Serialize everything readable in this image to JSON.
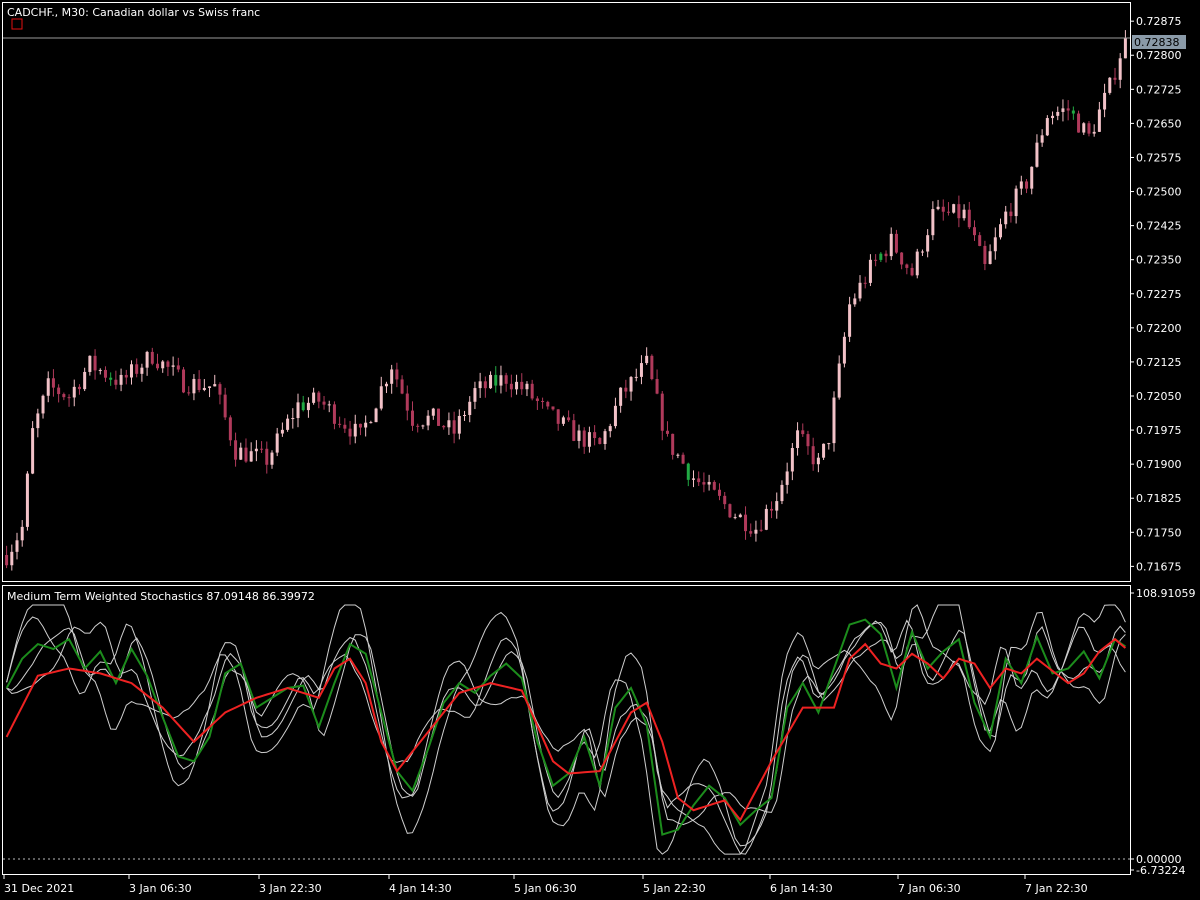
{
  "colors": {
    "background": "#000000",
    "frame": "#ffffff",
    "candle_up": "#f2c2c8",
    "candle_down": "#b03a5b",
    "candle_tick": "#22aa44",
    "bid_line": "#9a9a9a",
    "bid_tag": "#8a9aa8",
    "k_line": "#1c8c1c",
    "d_line": "#ee2222",
    "band_line": "#cfcfcf",
    "zero_line": "#bbbbbb"
  },
  "header": {
    "title": "CADCHF., M30:  Canadian dollar vs Swiss franc",
    "marker_icon": "red-square-icon"
  },
  "indicator": {
    "name": "Medium Term Weighted Stochastics",
    "value_k": "87.09148",
    "value_d": "86.39972"
  },
  "price_axis": {
    "ticks": [
      "0.72875",
      "0.72800",
      "0.72725",
      "0.72650",
      "0.72575",
      "0.72500",
      "0.72425",
      "0.72350",
      "0.72275",
      "0.72200",
      "0.72125",
      "0.72050",
      "0.71975",
      "0.71900",
      "0.71825",
      "0.71750",
      "0.71675"
    ],
    "current_price": "0.72838"
  },
  "indicator_axis": {
    "top_label": "108.91059",
    "zero_label": "0.00000",
    "bottom_label": "-6.73224"
  },
  "time_axis": {
    "labels": [
      "31 Dec 2021",
      "3 Jan 06:30",
      "3 Jan 22:30",
      "4 Jan 14:30",
      "5 Jan 06:30",
      "5 Jan 22:30",
      "6 Jan 14:30",
      "7 Jan 06:30",
      "7 Jan 22:30"
    ]
  },
  "chart_data": [
    {
      "type": "candlestick",
      "symbol": "CADCHF.",
      "timeframe": "M30",
      "description": "Canadian dollar vs Swiss franc",
      "ylim": [
        0.71645,
        0.72915
      ],
      "current_price": 0.72838,
      "bars": 216,
      "close_path": [
        [
          0,
          0.717
        ],
        [
          3,
          0.7176
        ],
        [
          5,
          0.7197
        ],
        [
          8,
          0.7207
        ],
        [
          12,
          0.7205
        ],
        [
          16,
          0.7212
        ],
        [
          22,
          0.7208
        ],
        [
          28,
          0.7214
        ],
        [
          34,
          0.7208
        ],
        [
          40,
          0.7207
        ],
        [
          44,
          0.7193
        ],
        [
          50,
          0.7191
        ],
        [
          56,
          0.7203
        ],
        [
          60,
          0.7204
        ],
        [
          64,
          0.72
        ],
        [
          68,
          0.7196
        ],
        [
          74,
          0.7212
        ],
        [
          78,
          0.72
        ],
        [
          82,
          0.72
        ],
        [
          86,
          0.7197
        ],
        [
          90,
          0.7206
        ],
        [
          96,
          0.7209
        ],
        [
          100,
          0.7206
        ],
        [
          104,
          0.7201
        ],
        [
          110,
          0.7196
        ],
        [
          114,
          0.7194
        ],
        [
          118,
          0.7205
        ],
        [
          123,
          0.7212
        ],
        [
          127,
          0.7195
        ],
        [
          132,
          0.7187
        ],
        [
          136,
          0.7183
        ],
        [
          140,
          0.7179
        ],
        [
          144,
          0.7176
        ],
        [
          148,
          0.7183
        ],
        [
          152,
          0.7196
        ],
        [
          156,
          0.719
        ],
        [
          158,
          0.7196
        ],
        [
          162,
          0.7225
        ],
        [
          166,
          0.7233
        ],
        [
          170,
          0.7239
        ],
        [
          174,
          0.7232
        ],
        [
          178,
          0.7245
        ],
        [
          184,
          0.7245
        ],
        [
          188,
          0.7233
        ],
        [
          192,
          0.7245
        ],
        [
          196,
          0.7252
        ],
        [
          200,
          0.7267
        ],
        [
          204,
          0.7268
        ],
        [
          208,
          0.7262
        ],
        [
          212,
          0.7273
        ],
        [
          215,
          0.7284
        ]
      ]
    },
    {
      "type": "line",
      "title": "Medium Term Weighted Stochastics",
      "ylim": [
        -6.73224,
        108.91059
      ],
      "last_values": [
        87.09148,
        86.39972
      ],
      "series": [
        {
          "color": "#1c8c1c",
          "points": [
            [
              0,
              70
            ],
            [
              3,
              82
            ],
            [
              6,
              88
            ],
            [
              9,
              86
            ],
            [
              12,
              90
            ],
            [
              15,
              78
            ],
            [
              18,
              85
            ],
            [
              21,
              72
            ],
            [
              24,
              86
            ],
            [
              27,
              75
            ],
            [
              30,
              58
            ],
            [
              33,
              42
            ],
            [
              36,
              40
            ],
            [
              39,
              50
            ],
            [
              42,
              76
            ],
            [
              45,
              80
            ],
            [
              48,
              62
            ],
            [
              51,
              66
            ],
            [
              54,
              70
            ],
            [
              57,
              71
            ],
            [
              60,
              54
            ],
            [
              63,
              72
            ],
            [
              66,
              88
            ],
            [
              69,
              84
            ],
            [
              72,
              60
            ],
            [
              75,
              36
            ],
            [
              78,
              28
            ],
            [
              81,
              45
            ],
            [
              84,
              64
            ],
            [
              87,
              72
            ],
            [
              90,
              68
            ],
            [
              93,
              75
            ],
            [
              96,
              80
            ],
            [
              99,
              74
            ],
            [
              102,
              48
            ],
            [
              105,
              30
            ],
            [
              108,
              35
            ],
            [
              111,
              50
            ],
            [
              114,
              30
            ],
            [
              117,
              62
            ],
            [
              120,
              70
            ],
            [
              123,
              55
            ],
            [
              126,
              10
            ],
            [
              129,
              12
            ],
            [
              132,
              22
            ],
            [
              135,
              30
            ],
            [
              138,
              25
            ],
            [
              141,
              14
            ],
            [
              144,
              20
            ],
            [
              147,
              25
            ],
            [
              150,
              62
            ],
            [
              153,
              72
            ],
            [
              156,
              60
            ],
            [
              159,
              78
            ],
            [
              162,
              96
            ],
            [
              165,
              98
            ],
            [
              168,
              92
            ],
            [
              171,
              70
            ],
            [
              174,
              93
            ],
            [
              177,
              78
            ],
            [
              180,
              85
            ],
            [
              183,
              90
            ],
            [
              186,
              64
            ],
            [
              189,
              50
            ],
            [
              192,
              82
            ],
            [
              195,
              72
            ],
            [
              198,
              91
            ],
            [
              201,
              76
            ],
            [
              204,
              78
            ],
            [
              207,
              85
            ],
            [
              210,
              74
            ],
            [
              213,
              90
            ],
            [
              215,
              87
            ]
          ]
        },
        {
          "color": "#ee2222",
          "points": [
            [
              0,
              50
            ],
            [
              6,
              75
            ],
            [
              12,
              78
            ],
            [
              18,
              76
            ],
            [
              24,
              72
            ],
            [
              30,
              62
            ],
            [
              36,
              48
            ],
            [
              42,
              60
            ],
            [
              48,
              66
            ],
            [
              54,
              70
            ],
            [
              60,
              66
            ],
            [
              63,
              78
            ],
            [
              66,
              82
            ],
            [
              69,
              72
            ],
            [
              72,
              48
            ],
            [
              75,
              36
            ],
            [
              81,
              52
            ],
            [
              87,
              68
            ],
            [
              93,
              72
            ],
            [
              99,
              69
            ],
            [
              105,
              40
            ],
            [
              108,
              35
            ],
            [
              114,
              36
            ],
            [
              120,
              60
            ],
            [
              123,
              64
            ],
            [
              126,
              48
            ],
            [
              129,
              25
            ],
            [
              132,
              20
            ],
            [
              138,
              24
            ],
            [
              141,
              16
            ],
            [
              147,
              40
            ],
            [
              153,
              62
            ],
            [
              156,
              62
            ],
            [
              159,
              62
            ],
            [
              162,
              82
            ],
            [
              165,
              88
            ],
            [
              168,
              80
            ],
            [
              171,
              78
            ],
            [
              174,
              84
            ],
            [
              177,
              80
            ],
            [
              180,
              74
            ],
            [
              183,
              82
            ],
            [
              186,
              80
            ],
            [
              189,
              70
            ],
            [
              192,
              78
            ],
            [
              195,
              76
            ],
            [
              198,
              82
            ],
            [
              201,
              77
            ],
            [
              204,
              72
            ],
            [
              207,
              76
            ],
            [
              210,
              85
            ],
            [
              213,
              90
            ],
            [
              215,
              86.4
            ]
          ]
        }
      ]
    }
  ]
}
